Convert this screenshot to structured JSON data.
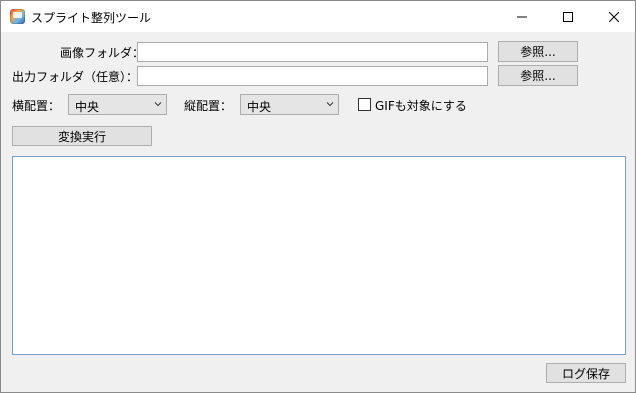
{
  "window": {
    "title": "スプライト整列ツール",
    "controls": [
      "minimize-icon",
      "maximize-icon",
      "close-icon"
    ]
  },
  "form": {
    "image_folder_label": "画像フォルダ：",
    "image_folder_value": "",
    "output_folder_label": "出力フォルダ（任意）：",
    "output_folder_value": "",
    "browse_label": "参照...",
    "h_align_label": "横配置：",
    "h_align_value": "中央",
    "v_align_label": "縦配置：",
    "v_align_value": "中央",
    "gif_checkbox_label": "GIFも対象にする",
    "gif_checkbox_checked": false,
    "run_button": "変換実行"
  },
  "log": {
    "content": "",
    "save_button": "ログ保存"
  },
  "colors": {
    "window_bg": "#f0f0f0",
    "titlebar_bg": "#ffffff",
    "button_bg": "#e1e1e1",
    "log_border": "#7a9cc6"
  }
}
